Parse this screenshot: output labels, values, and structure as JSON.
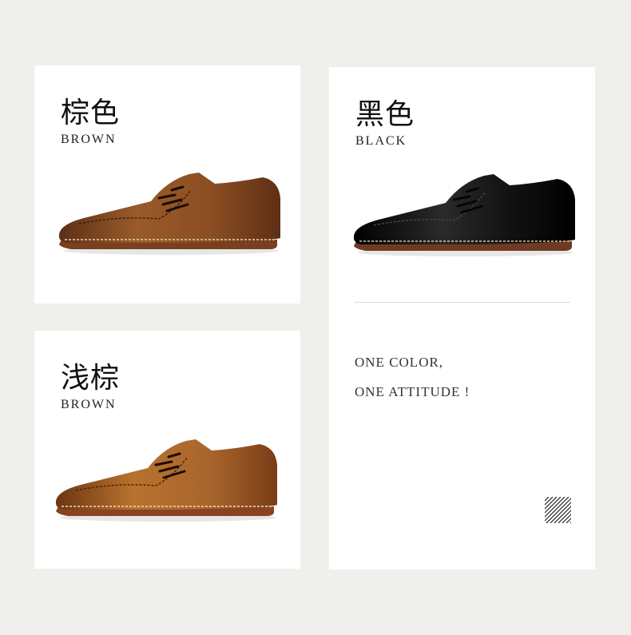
{
  "cards": {
    "brown": {
      "title_cn": "棕色",
      "title_en": "BROWN",
      "shoe_color": "#8a4d22",
      "sole_color": "#7a3f1e"
    },
    "light": {
      "title_cn": "浅棕",
      "title_en": "BROWN",
      "shoe_color": "#a8652c",
      "sole_color": "#8a4320"
    },
    "black": {
      "title_cn": "黑色",
      "title_en": "BLACK",
      "shoe_color": "#121212",
      "sole_color": "#6e3a22"
    }
  },
  "slogan": {
    "line1": "ONE COLOR,",
    "line2": "ONE ATTITUDE !"
  },
  "icons": {
    "decor": "diagonal-stripes-icon",
    "shoe": "oxford-shoe-icon"
  }
}
